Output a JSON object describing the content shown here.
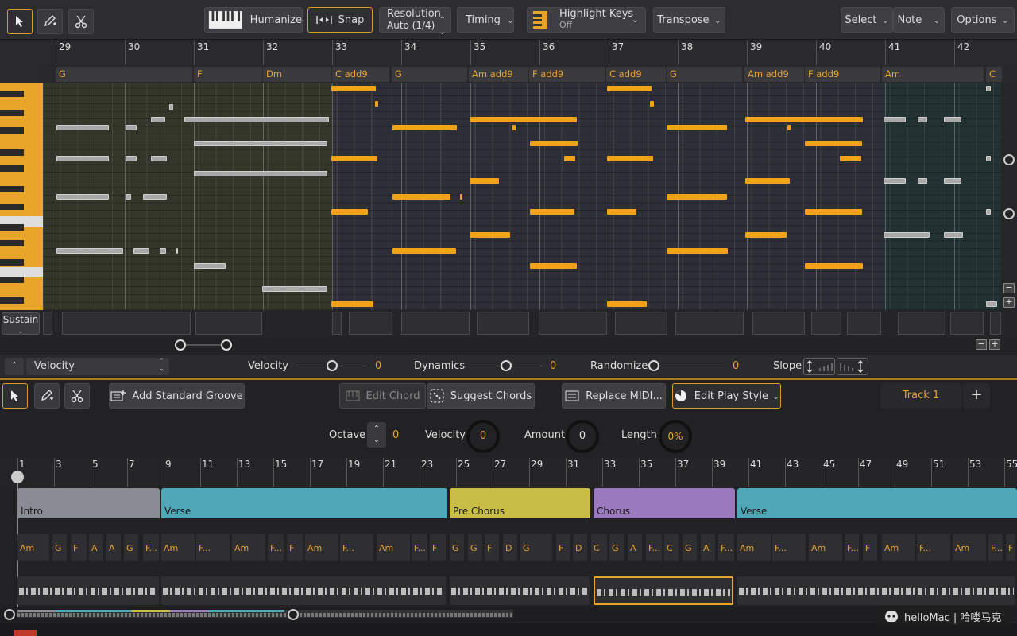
{
  "toolbar": {
    "humanize_label": "Humanize",
    "snap_label": "Snap",
    "resolution_label": "Resolution",
    "resolution_value": "Auto (1/4)",
    "timing_label": "Timing",
    "highlight_label": "Highlight Keys",
    "highlight_value": "Off",
    "transpose_label": "Transpose",
    "select_label": "Select",
    "note_label": "Note",
    "options_label": "Options"
  },
  "ruler": {
    "bars": [
      "29",
      "30",
      "31",
      "32",
      "33",
      "34",
      "35",
      "36",
      "37",
      "38",
      "39",
      "40",
      "41",
      "42"
    ]
  },
  "chord_strip": [
    "G",
    "F",
    "Dm",
    "C add9",
    "G",
    "Am add9",
    "F add9",
    "C add9",
    "G",
    "Am add9",
    "F add9",
    "Am",
    "C"
  ],
  "sustain_label": "Sustain",
  "velocity_bar": {
    "lane_select": "Velocity",
    "velocity_label": "Velocity",
    "velocity_value": "0",
    "dynamics_label": "Dynamics",
    "dynamics_value": "0",
    "randomize_label": "Randomize",
    "randomize_value": "0",
    "slope_label": "Slope"
  },
  "toolbar2": {
    "add_groove": "Add Standard Groove",
    "edit_chord": "Edit Chord",
    "suggest_chords": "Suggest Chords",
    "replace_midi": "Replace MIDI...",
    "edit_play_style": "Edit Play Style",
    "track": "Track 1"
  },
  "params": {
    "octave_label": "Octave",
    "octave_value": "0",
    "velocity_label": "Velocity",
    "velocity_value": "0",
    "amount_label": "Amount",
    "amount_value": "0",
    "length_label": "Length",
    "length_value": "0%"
  },
  "arrangement_ruler": [
    "1",
    "3",
    "5",
    "7",
    "9",
    "11",
    "13",
    "15",
    "17",
    "19",
    "21",
    "23",
    "25",
    "27",
    "29",
    "31",
    "33",
    "35",
    "37",
    "39",
    "41",
    "43",
    "45",
    "47",
    "49",
    "51",
    "53",
    "55"
  ],
  "sections": [
    {
      "name": "Intro",
      "color": "#8a8c95"
    },
    {
      "name": "Verse",
      "color": "#4fa7b8"
    },
    {
      "name": "Pre Chorus",
      "color": "#c9be45"
    },
    {
      "name": "Chorus",
      "color": "#9a79bf"
    },
    {
      "name": "Verse",
      "color": "#4fa7b8"
    }
  ],
  "arr_chords": [
    "Am",
    "G",
    "F",
    "A",
    "A",
    "G",
    "F...",
    "Am",
    "F...",
    "Am",
    "F...",
    "F",
    "Am",
    "F...",
    "Am",
    "F...",
    "F",
    "G",
    "G",
    "F",
    "D",
    "G",
    "F",
    "D",
    "C",
    "G",
    "A",
    "F...",
    "C",
    "G",
    "A",
    "F...",
    "Am",
    "F...",
    "Am",
    "F...",
    "F",
    "Am",
    "F...",
    "Am",
    "F...",
    "F"
  ],
  "watermark": "helloMac | 哈喽马克"
}
